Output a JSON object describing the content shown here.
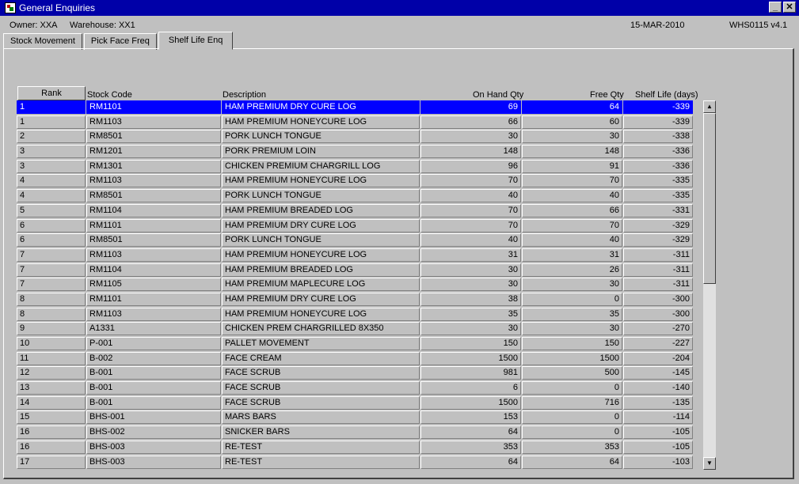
{
  "window": {
    "title": "General Enquiries",
    "minimize_label": "_",
    "close_label": "✕"
  },
  "info": {
    "owner": "Owner:  XXA",
    "warehouse": "Warehouse:  XX1",
    "date": "15-MAR-2010",
    "version": "WHS0115  v4.1"
  },
  "tabs": [
    {
      "label": "Stock Movement"
    },
    {
      "label": "Pick Face Freq"
    },
    {
      "label": "Shelf Life Enq"
    }
  ],
  "table": {
    "headers": {
      "rank": "Rank",
      "stock_code": "Stock Code",
      "description": "Description",
      "on_hand": "On Hand Qty",
      "free": "Free Qty",
      "shelf_life": "Shelf Life (days)"
    },
    "rows": [
      [
        "1",
        "RM1101",
        "HAM PREMIUM DRY CURE LOG",
        "69",
        "64",
        "-339"
      ],
      [
        "1",
        "RM1103",
        "HAM PREMIUM HONEYCURE LOG",
        "66",
        "60",
        "-339"
      ],
      [
        "2",
        "RM8501",
        "PORK LUNCH TONGUE",
        "30",
        "30",
        "-338"
      ],
      [
        "3",
        "RM1201",
        "PORK PREMIUM LOIN",
        "148",
        "148",
        "-336"
      ],
      [
        "3",
        "RM1301",
        "CHICKEN PREMIUM CHARGRILL LOG",
        "96",
        "91",
        "-336"
      ],
      [
        "4",
        "RM1103",
        "HAM PREMIUM HONEYCURE LOG",
        "70",
        "70",
        "-335"
      ],
      [
        "4",
        "RM8501",
        "PORK LUNCH TONGUE",
        "40",
        "40",
        "-335"
      ],
      [
        "5",
        "RM1104",
        "HAM PREMIUM BREADED LOG",
        "70",
        "66",
        "-331"
      ],
      [
        "6",
        "RM1101",
        "HAM PREMIUM DRY CURE LOG",
        "70",
        "70",
        "-329"
      ],
      [
        "6",
        "RM8501",
        "PORK LUNCH TONGUE",
        "40",
        "40",
        "-329"
      ],
      [
        "7",
        "RM1103",
        "HAM PREMIUM HONEYCURE LOG",
        "31",
        "31",
        "-311"
      ],
      [
        "7",
        "RM1104",
        "HAM PREMIUM BREADED LOG",
        "30",
        "26",
        "-311"
      ],
      [
        "7",
        "RM1105",
        "HAM PREMIUM MAPLECURE LOG",
        "30",
        "30",
        "-311"
      ],
      [
        "8",
        "RM1101",
        "HAM PREMIUM DRY CURE LOG",
        "38",
        "0",
        "-300"
      ],
      [
        "8",
        "RM1103",
        "HAM PREMIUM HONEYCURE LOG",
        "35",
        "35",
        "-300"
      ],
      [
        "9",
        "A1331",
        "CHICKEN PREM CHARGRILLED 8X350",
        "30",
        "30",
        "-270"
      ],
      [
        "10",
        "P-001",
        "PALLET MOVEMENT",
        "150",
        "150",
        "-227"
      ],
      [
        "11",
        "B-002",
        "FACE CREAM",
        "1500",
        "1500",
        "-204"
      ],
      [
        "12",
        "B-001",
        "FACE SCRUB",
        "981",
        "500",
        "-145"
      ],
      [
        "13",
        "B-001",
        "FACE SCRUB",
        "6",
        "0",
        "-140"
      ],
      [
        "14",
        "B-001",
        "FACE SCRUB",
        "1500",
        "716",
        "-135"
      ],
      [
        "15",
        "BHS-001",
        "MARS BARS",
        "153",
        "0",
        "-114"
      ],
      [
        "16",
        "BHS-002",
        "SNICKER BARS",
        "64",
        "0",
        "-105"
      ],
      [
        "16",
        "BHS-003",
        "RE-TEST",
        "353",
        "353",
        "-105"
      ],
      [
        "17",
        "BHS-003",
        "RE-TEST",
        "64",
        "64",
        "-103"
      ]
    ]
  },
  "scroll": {
    "up_label": "▲",
    "down_label": "▼"
  }
}
